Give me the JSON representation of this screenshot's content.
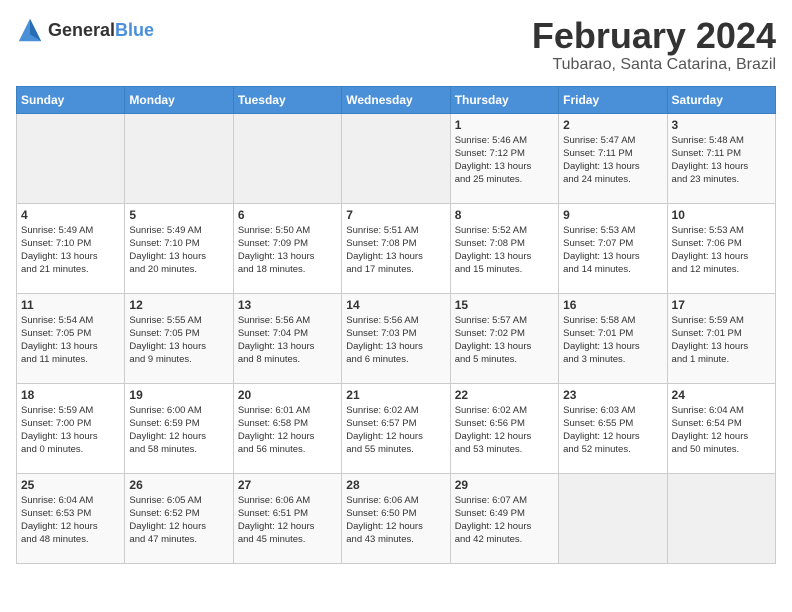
{
  "header": {
    "logo_general": "General",
    "logo_blue": "Blue",
    "month_year": "February 2024",
    "location": "Tubarao, Santa Catarina, Brazil"
  },
  "weekdays": [
    "Sunday",
    "Monday",
    "Tuesday",
    "Wednesday",
    "Thursday",
    "Friday",
    "Saturday"
  ],
  "weeks": [
    [
      {
        "day": "",
        "info": ""
      },
      {
        "day": "",
        "info": ""
      },
      {
        "day": "",
        "info": ""
      },
      {
        "day": "",
        "info": ""
      },
      {
        "day": "1",
        "info": "Sunrise: 5:46 AM\nSunset: 7:12 PM\nDaylight: 13 hours\nand 25 minutes."
      },
      {
        "day": "2",
        "info": "Sunrise: 5:47 AM\nSunset: 7:11 PM\nDaylight: 13 hours\nand 24 minutes."
      },
      {
        "day": "3",
        "info": "Sunrise: 5:48 AM\nSunset: 7:11 PM\nDaylight: 13 hours\nand 23 minutes."
      }
    ],
    [
      {
        "day": "4",
        "info": "Sunrise: 5:49 AM\nSunset: 7:10 PM\nDaylight: 13 hours\nand 21 minutes."
      },
      {
        "day": "5",
        "info": "Sunrise: 5:49 AM\nSunset: 7:10 PM\nDaylight: 13 hours\nand 20 minutes."
      },
      {
        "day": "6",
        "info": "Sunrise: 5:50 AM\nSunset: 7:09 PM\nDaylight: 13 hours\nand 18 minutes."
      },
      {
        "day": "7",
        "info": "Sunrise: 5:51 AM\nSunset: 7:08 PM\nDaylight: 13 hours\nand 17 minutes."
      },
      {
        "day": "8",
        "info": "Sunrise: 5:52 AM\nSunset: 7:08 PM\nDaylight: 13 hours\nand 15 minutes."
      },
      {
        "day": "9",
        "info": "Sunrise: 5:53 AM\nSunset: 7:07 PM\nDaylight: 13 hours\nand 14 minutes."
      },
      {
        "day": "10",
        "info": "Sunrise: 5:53 AM\nSunset: 7:06 PM\nDaylight: 13 hours\nand 12 minutes."
      }
    ],
    [
      {
        "day": "11",
        "info": "Sunrise: 5:54 AM\nSunset: 7:05 PM\nDaylight: 13 hours\nand 11 minutes."
      },
      {
        "day": "12",
        "info": "Sunrise: 5:55 AM\nSunset: 7:05 PM\nDaylight: 13 hours\nand 9 minutes."
      },
      {
        "day": "13",
        "info": "Sunrise: 5:56 AM\nSunset: 7:04 PM\nDaylight: 13 hours\nand 8 minutes."
      },
      {
        "day": "14",
        "info": "Sunrise: 5:56 AM\nSunset: 7:03 PM\nDaylight: 13 hours\nand 6 minutes."
      },
      {
        "day": "15",
        "info": "Sunrise: 5:57 AM\nSunset: 7:02 PM\nDaylight: 13 hours\nand 5 minutes."
      },
      {
        "day": "16",
        "info": "Sunrise: 5:58 AM\nSunset: 7:01 PM\nDaylight: 13 hours\nand 3 minutes."
      },
      {
        "day": "17",
        "info": "Sunrise: 5:59 AM\nSunset: 7:01 PM\nDaylight: 13 hours\nand 1 minute."
      }
    ],
    [
      {
        "day": "18",
        "info": "Sunrise: 5:59 AM\nSunset: 7:00 PM\nDaylight: 13 hours\nand 0 minutes."
      },
      {
        "day": "19",
        "info": "Sunrise: 6:00 AM\nSunset: 6:59 PM\nDaylight: 12 hours\nand 58 minutes."
      },
      {
        "day": "20",
        "info": "Sunrise: 6:01 AM\nSunset: 6:58 PM\nDaylight: 12 hours\nand 56 minutes."
      },
      {
        "day": "21",
        "info": "Sunrise: 6:02 AM\nSunset: 6:57 PM\nDaylight: 12 hours\nand 55 minutes."
      },
      {
        "day": "22",
        "info": "Sunrise: 6:02 AM\nSunset: 6:56 PM\nDaylight: 12 hours\nand 53 minutes."
      },
      {
        "day": "23",
        "info": "Sunrise: 6:03 AM\nSunset: 6:55 PM\nDaylight: 12 hours\nand 52 minutes."
      },
      {
        "day": "24",
        "info": "Sunrise: 6:04 AM\nSunset: 6:54 PM\nDaylight: 12 hours\nand 50 minutes."
      }
    ],
    [
      {
        "day": "25",
        "info": "Sunrise: 6:04 AM\nSunset: 6:53 PM\nDaylight: 12 hours\nand 48 minutes."
      },
      {
        "day": "26",
        "info": "Sunrise: 6:05 AM\nSunset: 6:52 PM\nDaylight: 12 hours\nand 47 minutes."
      },
      {
        "day": "27",
        "info": "Sunrise: 6:06 AM\nSunset: 6:51 PM\nDaylight: 12 hours\nand 45 minutes."
      },
      {
        "day": "28",
        "info": "Sunrise: 6:06 AM\nSunset: 6:50 PM\nDaylight: 12 hours\nand 43 minutes."
      },
      {
        "day": "29",
        "info": "Sunrise: 6:07 AM\nSunset: 6:49 PM\nDaylight: 12 hours\nand 42 minutes."
      },
      {
        "day": "",
        "info": ""
      },
      {
        "day": "",
        "info": ""
      }
    ]
  ]
}
